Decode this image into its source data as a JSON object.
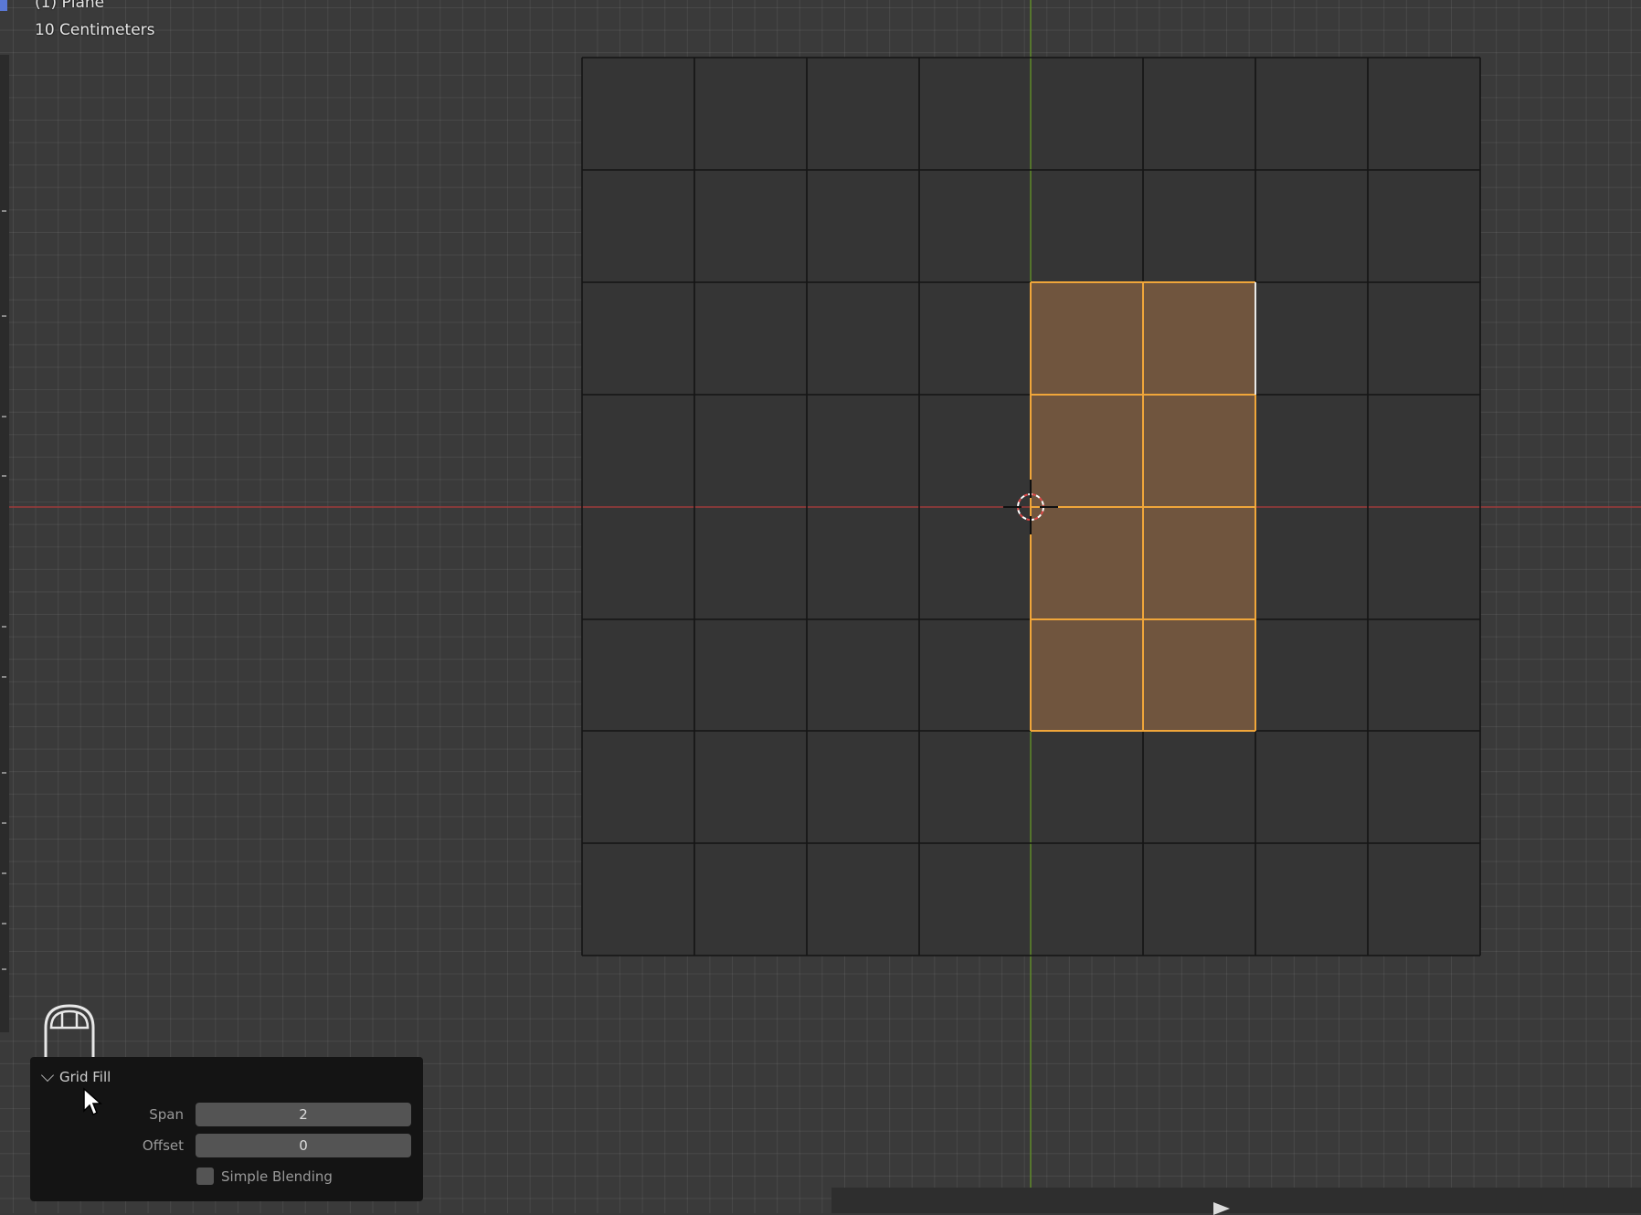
{
  "overlay": {
    "object_name": "(1) Plane",
    "grid_scale": "10 Centimeters"
  },
  "operator_panel": {
    "title": "Grid Fill",
    "span_label": "Span",
    "span_value": "2",
    "offset_label": "Offset",
    "offset_value": "0",
    "simple_blending_label": "Simple Blending",
    "simple_blending_checked": false
  },
  "colors": {
    "viewport_bg": "#3a3a3a",
    "selected_face": "#7a5b40",
    "selected_edge": "#f0a63a",
    "x_axis": "#a83a3a",
    "y_axis": "#5f8a2a",
    "panel_bg": "#141414"
  },
  "icons": {
    "cursor_3d": "3d-cursor-icon",
    "mouse": "mouse-icon",
    "pointer": "pointer-cursor-icon"
  }
}
